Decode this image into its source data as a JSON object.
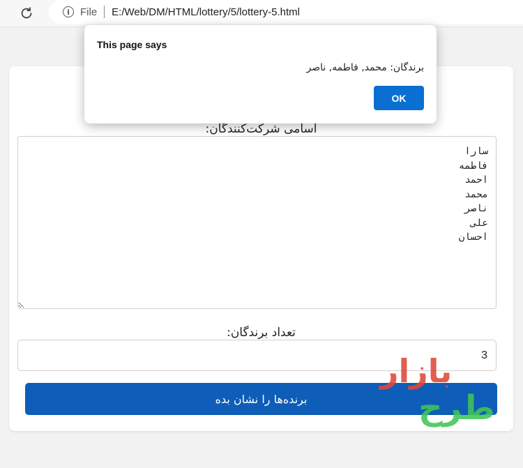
{
  "browser": {
    "scheme_label": "File",
    "url": "E:/Web/DM/HTML/lottery/5/lottery-5.html"
  },
  "form": {
    "participants_label": "اسامی شرکت‌کنندگان:",
    "participants_value": "سارا\nفاطمه\nاحمد\nمحمد\nناصر\nعلی\nاحسان",
    "winners_count_label": "تعداد برندگان:",
    "winners_count_value": "3",
    "show_winners_button": "برنده‌ها را نشان بده"
  },
  "alert": {
    "title": "This page says",
    "message": "برندگان: محمد, فاطمه, ناصر",
    "ok_label": "OK"
  },
  "watermark": {
    "line1": "بازار",
    "line2": "طرح"
  },
  "colors": {
    "primary_button": "#0e5db8",
    "ok_button": "#0a6fd0",
    "watermark_red": "#e0473a",
    "watermark_green": "#3fc556"
  }
}
